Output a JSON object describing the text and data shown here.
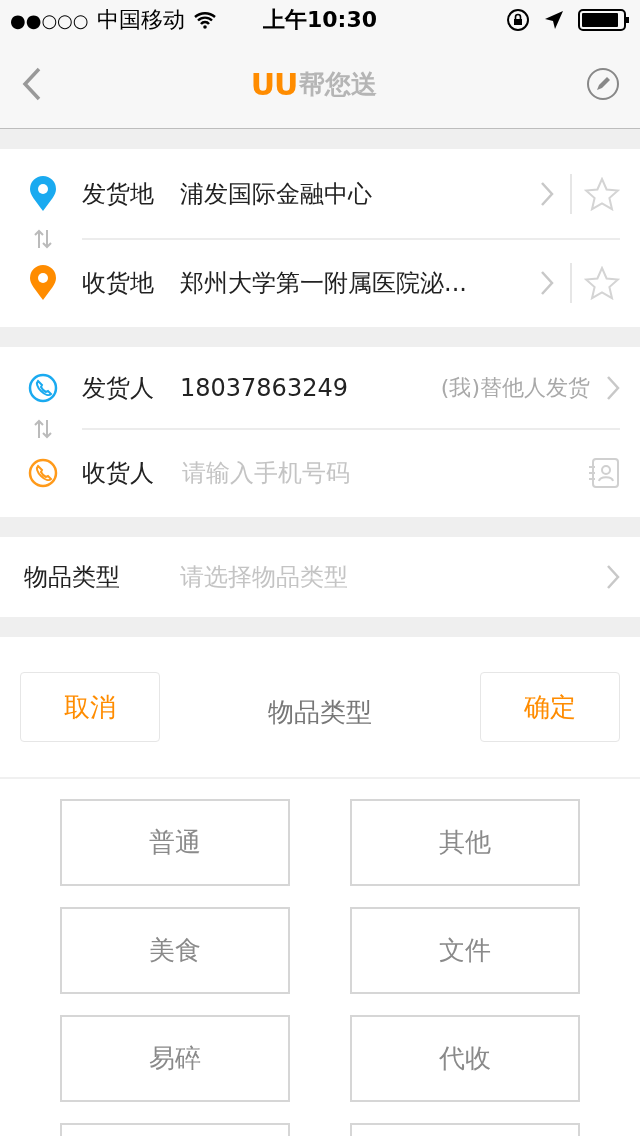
{
  "status_bar": {
    "signal": "●●○○○",
    "carrier": "中国移动",
    "time": "上午10:30"
  },
  "nav": {
    "logo_mark": "UU",
    "title": "帮您送"
  },
  "addresses": [
    {
      "label": "发货地",
      "value": "浦发国际金融中心",
      "color": "#1aaaf0"
    },
    {
      "label": "收货地",
      "value": "郑州大学第一附属医院泌...",
      "color": "#ff8c00"
    }
  ],
  "contacts": [
    {
      "label": "发货人",
      "value": "18037863249",
      "hint": "(我)替他人发货",
      "color": "#1aaaf0",
      "kind": "link"
    },
    {
      "label": "收货人",
      "placeholder": "请输入手机号码",
      "color": "#ff9a1a",
      "kind": "input"
    }
  ],
  "item_type": {
    "label": "物品类型",
    "placeholder": "请选择物品类型"
  },
  "picker": {
    "cancel": "取消",
    "title": "物品类型",
    "confirm": "确定",
    "options": [
      {
        "label": "普通",
        "selected": false
      },
      {
        "label": "其他",
        "selected": false
      },
      {
        "label": "美食",
        "selected": false
      },
      {
        "label": "文件",
        "selected": false
      },
      {
        "label": "易碎",
        "selected": false
      },
      {
        "label": "代收",
        "selected": false
      }
    ],
    "partial_row": true
  }
}
